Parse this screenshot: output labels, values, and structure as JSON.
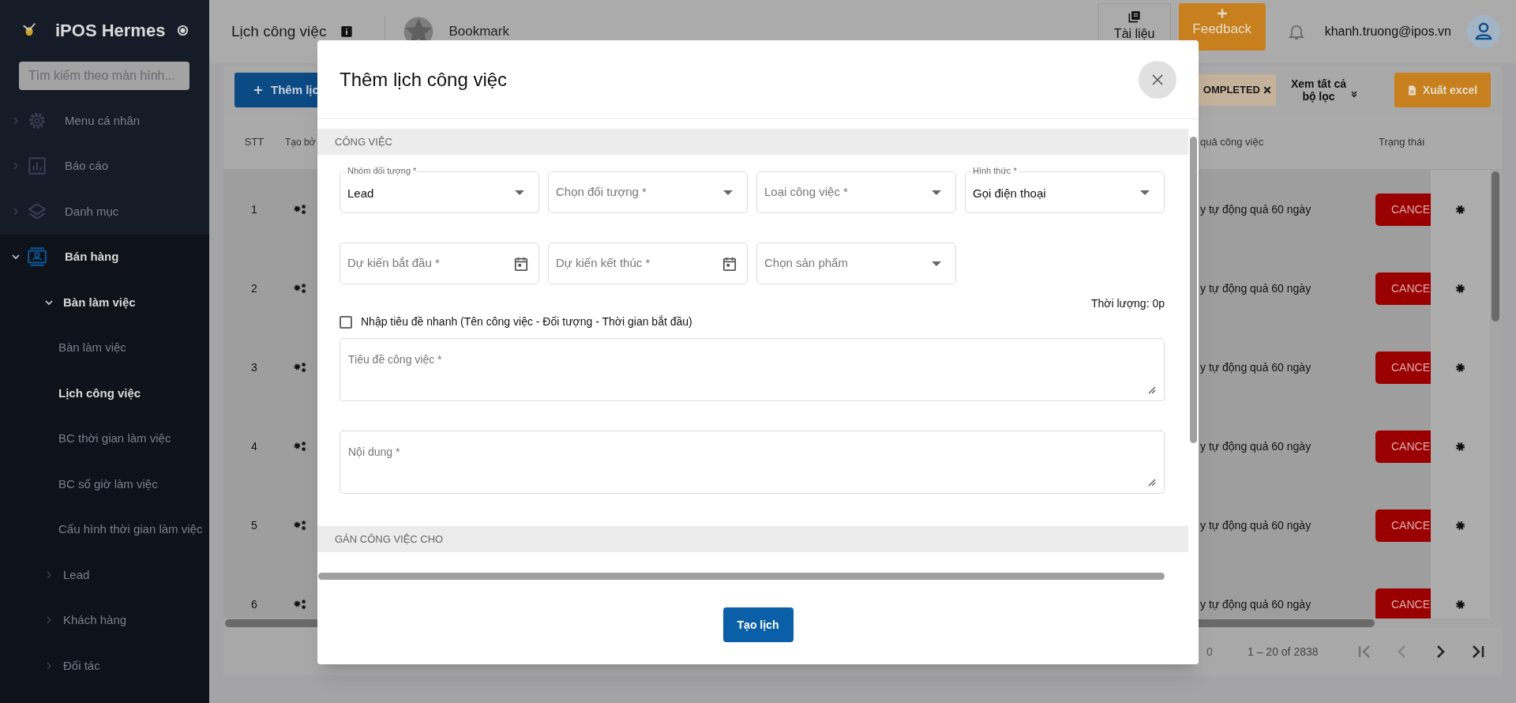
{
  "sidebar": {
    "brand": "iPOS Hermes",
    "search_placeholder": "Tìm kiếm theo màn hình...",
    "items": [
      {
        "label": "Menu cá nhân",
        "expanded": false
      },
      {
        "label": "Báo cáo",
        "expanded": false
      },
      {
        "label": "Danh mục",
        "expanded": false
      },
      {
        "label": "Bán hàng",
        "expanded": true,
        "children": [
          {
            "label": "Bàn làm việc",
            "expanded": true,
            "children": [
              {
                "label": "Bàn làm việc",
                "selected": false
              },
              {
                "label": "Lịch công việc",
                "selected": true
              },
              {
                "label": "BC thời gian làm việc",
                "selected": false
              },
              {
                "label": "BC số giờ làm việc",
                "selected": false
              },
              {
                "label": "Cấu hình thời gian làm việc",
                "selected": false
              }
            ]
          },
          {
            "label": "Lead",
            "expanded": false
          },
          {
            "label": "Khách hàng",
            "expanded": false
          },
          {
            "label": "Đối tác",
            "expanded": false
          }
        ]
      }
    ]
  },
  "topbar": {
    "page_title": "Lịch công việc",
    "bookmark": "Bookmark",
    "docs": "Tài liệu",
    "feedback": "Feedback",
    "user_email": "khanh.truong@ipos.vn"
  },
  "toolbar": {
    "add_button": "Thêm lịc",
    "filter_chip": "OMPLETED",
    "view_filters": "Xem tất cả bộ lọc",
    "export_button": "Xuất excel"
  },
  "table": {
    "columns": [
      "STT",
      "Tạo bở",
      "quả công việc",
      "Trạng thái"
    ],
    "rows": [
      {
        "stt": "1",
        "result": "y tự động quả 60 ngày",
        "status": "CANCE"
      },
      {
        "stt": "2",
        "result": "y tự động quả 60 ngày",
        "status": "CANCE"
      },
      {
        "stt": "3",
        "result": "y tự động quả 60 ngày",
        "status": "CANCE"
      },
      {
        "stt": "4",
        "result": "y tự động quả 60 ngày",
        "status": "CANCE"
      },
      {
        "stt": "5",
        "result": "y tự động quả 60 ngày",
        "status": "CANCE"
      },
      {
        "stt": "6",
        "result": "y tự động quả 60 ngày",
        "status": "CANCE"
      }
    ]
  },
  "pagination": {
    "page_size": "0",
    "range": "1 – 20 of 2838"
  },
  "modal": {
    "title": "Thêm lịch công việc",
    "section_1": "CÔNG VIỆC",
    "fields": [
      {
        "kind": "select",
        "label": "Nhóm đối tượng *",
        "value": "Lead"
      },
      {
        "kind": "select",
        "placeholder": "Chọn đối tượng *"
      },
      {
        "kind": "select",
        "placeholder": "Loại công việc *"
      },
      {
        "kind": "select",
        "label": "Hình thức *",
        "value": "Gọi điện thoại"
      },
      {
        "kind": "date",
        "placeholder": "Dự kiến bắt đầu *"
      },
      {
        "kind": "date",
        "placeholder": "Dự kiến kết thúc *"
      },
      {
        "kind": "select",
        "placeholder": "Chọn sản phẩm"
      }
    ],
    "duration": "Thời lượng: 0p",
    "quick_title": {
      "label": "Nhập tiêu đề nhanh (Tên công việc - Đối tượng - Thời gian bắt đầu)",
      "checked": false
    },
    "textareas": [
      {
        "placeholder": "Tiêu đề công việc *"
      },
      {
        "placeholder": "Nội dung *"
      }
    ],
    "section_2": "GÁN CÔNG VIỆC CHO",
    "submit": "Tạo lịch"
  }
}
